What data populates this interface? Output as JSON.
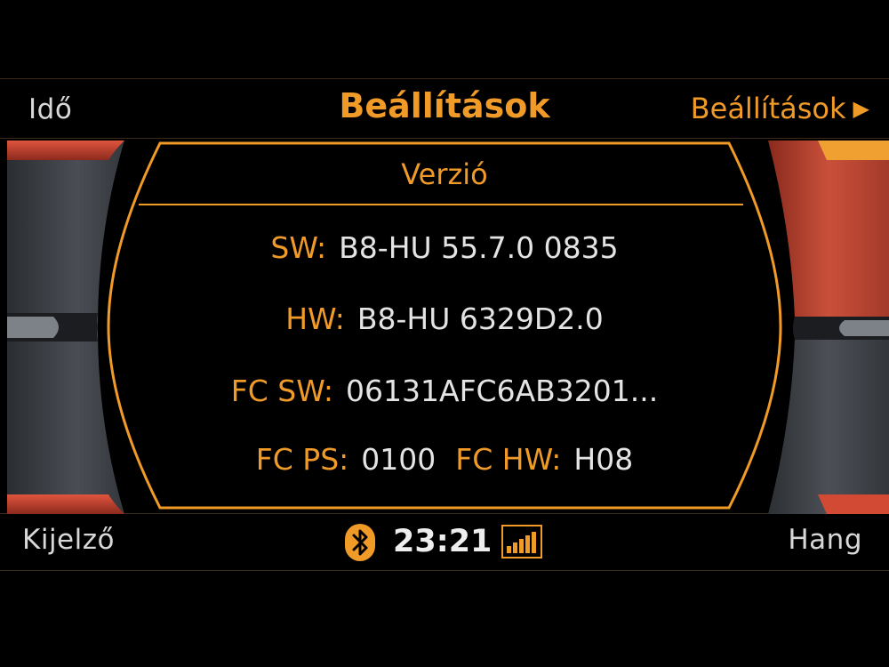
{
  "softkeys": {
    "top_left": "Idő",
    "top_right": "Beállítások",
    "bottom_left": "Kijelző",
    "bottom_right": "Hang"
  },
  "header": {
    "title": "Beállítások"
  },
  "panel": {
    "title": "Verzió",
    "rows": {
      "sw": {
        "label": "SW:",
        "value": "B8-HU 55.7.0 0835"
      },
      "hw": {
        "label": "HW:",
        "value": "B8-HU 6329D2.0"
      },
      "fc_sw": {
        "label": "FC SW:",
        "value": "06131AFC6AB3201..."
      },
      "fc_ps": {
        "label": "FC PS:",
        "value": "0100"
      },
      "fc_hw": {
        "label": "FC HW:",
        "value": "H08"
      }
    }
  },
  "status": {
    "time": "23:21",
    "bluetooth_icon": "bluetooth-icon",
    "signal_icon": "signal-strength-icon"
  },
  "colors": {
    "accent": "#f09a28",
    "text": "#e4e4e4",
    "knob_red": "#c0392b",
    "knob_grey": "#3c4046"
  }
}
